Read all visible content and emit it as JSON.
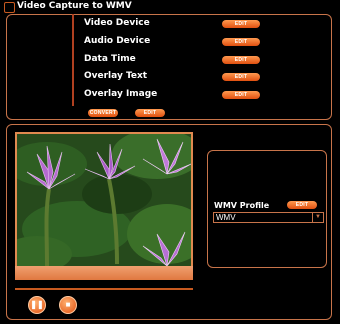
{
  "window": {
    "title": "Video Capture to WMV"
  },
  "settings": {
    "rows": [
      {
        "label": "Video Device",
        "button": "EDIT"
      },
      {
        "label": "Audio Device",
        "button": "EDIT"
      },
      {
        "label": "Data Time",
        "button": "EDIT"
      },
      {
        "label": "Overlay Text",
        "button": "EDIT"
      },
      {
        "label": "Overlay Image",
        "button": "EDIT"
      }
    ],
    "convert_label": "CONVERT",
    "edit_label": "EDIT"
  },
  "profile": {
    "label": "WMV Profile",
    "edit_label": "EDIT",
    "selected": "WMV"
  },
  "controls": {
    "pause_icon": "pause-icon",
    "stop_icon": "stop-icon"
  },
  "colors": {
    "accent": "#e86a20",
    "border": "#c8744a",
    "background": "#000000"
  }
}
